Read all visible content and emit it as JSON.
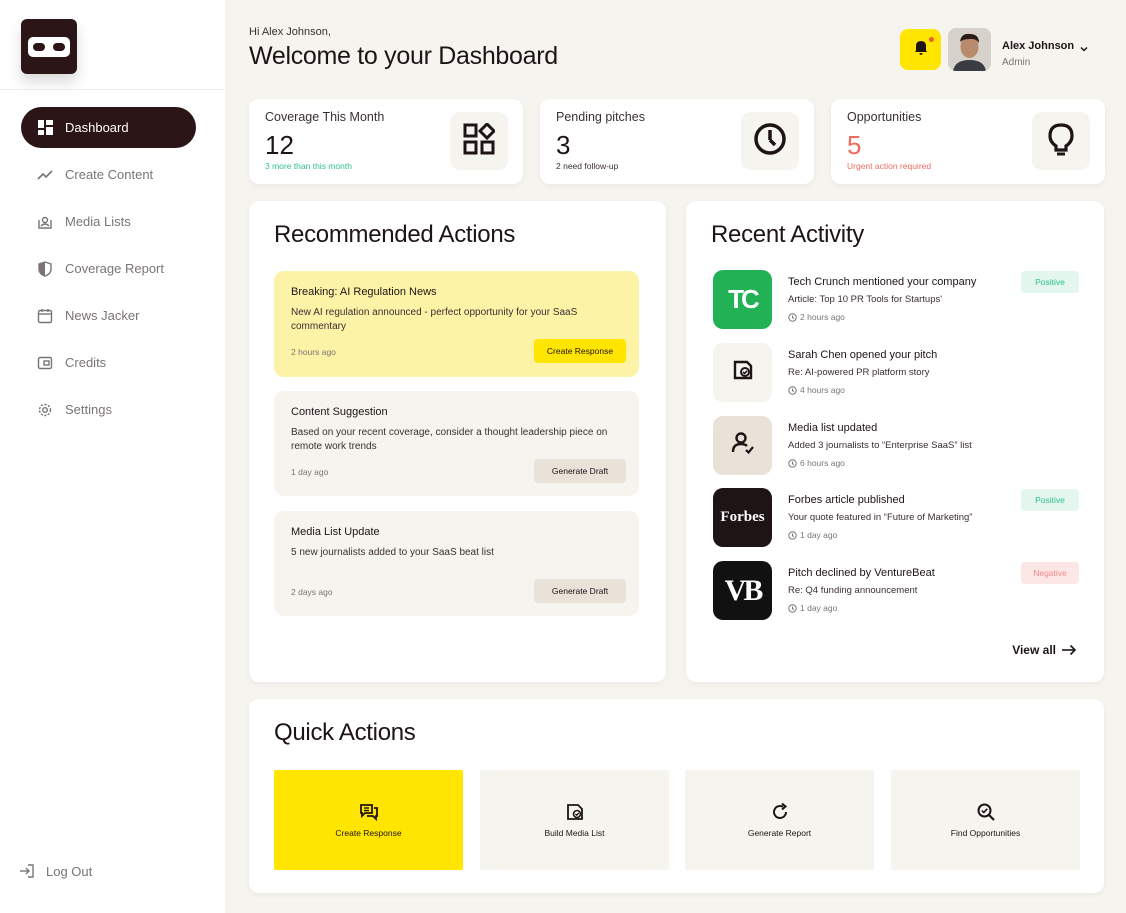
{
  "sidebar": {
    "items": [
      {
        "label": "Dashboard",
        "icon": "grid-icon",
        "active": true
      },
      {
        "label": "Create Content",
        "icon": "trend-line-icon"
      },
      {
        "label": "Media Lists",
        "icon": "user-list-icon"
      },
      {
        "label": "Coverage Report",
        "icon": "shield-icon"
      },
      {
        "label": "News Jacker",
        "icon": "calendar-icon"
      },
      {
        "label": "Credits",
        "icon": "wallet-icon"
      },
      {
        "label": "Settings",
        "icon": "gear-icon"
      }
    ],
    "logout": "Log Out"
  },
  "header": {
    "greeting": "Hi Alex Johnson,",
    "title": "Welcome to your Dashboard",
    "user_name": "Alex Johnson",
    "user_role": "Admin"
  },
  "stats": [
    {
      "label": "Coverage This Month",
      "value": "12",
      "sub": "3 more than this month",
      "sub_color": "#2fc18c",
      "icon": "apps-grid-icon"
    },
    {
      "label": "Pending pitches",
      "value": "3",
      "sub": "2 need follow-up",
      "sub_color": "#3a2f31",
      "icon": "clock-icon"
    },
    {
      "label": "Opportunities",
      "value": "5",
      "sub": "Urgent action required",
      "sub_color": "#ef6b5f",
      "value_color": "#ef6b5f",
      "icon": "lightbulb-icon"
    }
  ],
  "recommended": {
    "title": "Recommended Actions",
    "items": [
      {
        "title": "Breaking: AI Regulation News",
        "desc": "New AI regulation announced - perfect opportunity for your SaaS commentary",
        "time": "2 hours ago",
        "button": "Create Response"
      },
      {
        "title": "Content Suggestion",
        "desc": "Based on your recent coverage, consider a thought leadership piece on remote work trends",
        "time": "1 day ago",
        "button": "Generate Draft"
      },
      {
        "title": "Media List Update",
        "desc": "5 new journalists added to your SaaS beat list",
        "time": "2 days ago",
        "button": "Generate Draft"
      }
    ]
  },
  "activity": {
    "title": "Recent Activity",
    "items": [
      {
        "title": "Tech Crunch mentioned your company",
        "desc": "Article: Top 10 PR Tools for Startups'",
        "time": "2 hours ago",
        "badge": "Positive",
        "logo_text": "TC"
      },
      {
        "title": "Sarah Chen opened your pitch",
        "desc": "Re: AI-powered PR platform story",
        "time": "4 hours ago",
        "badge": ""
      },
      {
        "title": "Media list updated",
        "desc": "Added 3 journalists to “Enterprise SaaS” list",
        "time": "6 hours ago",
        "badge": ""
      },
      {
        "title": "Forbes article published",
        "desc": "Your quote featured in “Future of Marketing”",
        "time": "1 day ago",
        "badge": "Positive",
        "logo_text": "Forbes"
      },
      {
        "title": "Pitch declined by VentureBeat",
        "desc": "Re: Q4 funding announcement",
        "time": "1 day ago",
        "badge": "Negative",
        "logo_text": "VB"
      }
    ],
    "view_all": "View all"
  },
  "quick_actions": {
    "title": "Quick Actions",
    "items": [
      {
        "label": "Create Response",
        "icon": "chat-icon"
      },
      {
        "label": "Build Media List",
        "icon": "tag-check-icon"
      },
      {
        "label": "Generate Report",
        "icon": "refresh-icon"
      },
      {
        "label": "Find Opportunities",
        "icon": "search-check-icon"
      }
    ]
  },
  "colors": {
    "brand_dark": "#2b1517",
    "accent_yellow": "#ffe500",
    "positive": "#2fc18c",
    "negative": "#ef6b5f"
  }
}
